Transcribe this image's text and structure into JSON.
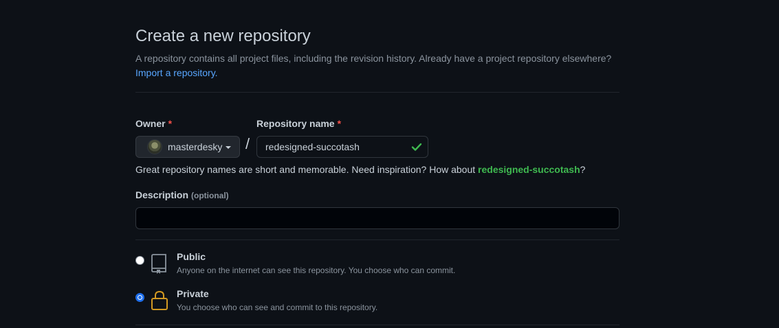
{
  "header": {
    "title": "Create a new repository",
    "subtitle": "A repository contains all project files, including the revision history. Already have a project repository elsewhere?",
    "import_link": "Import a repository."
  },
  "owner": {
    "label": "Owner",
    "required_mark": "*",
    "value": "masterdesky"
  },
  "separator": "/",
  "repository_name": {
    "label": "Repository name",
    "required_mark": "*",
    "value": "redesigned-succotash"
  },
  "hint": {
    "text": "Great repository names are short and memorable. Need inspiration? How about ",
    "suggestion": "redesigned-succotash",
    "end": "?"
  },
  "description": {
    "label": "Description",
    "optional_label": "(optional)",
    "value": ""
  },
  "visibility": {
    "options": [
      {
        "title": "Public",
        "description": "Anyone on the internet can see this repository. You choose who can commit.",
        "selected": false,
        "icon": "repo-icon"
      },
      {
        "title": "Private",
        "description": "You choose who can see and commit to this repository.",
        "selected": true,
        "icon": "lock-icon"
      }
    ]
  },
  "colors": {
    "background": "#0d1117",
    "link": "#58a6ff",
    "success": "#3fb950",
    "required": "#f85149",
    "private_icon": "#d29922"
  }
}
